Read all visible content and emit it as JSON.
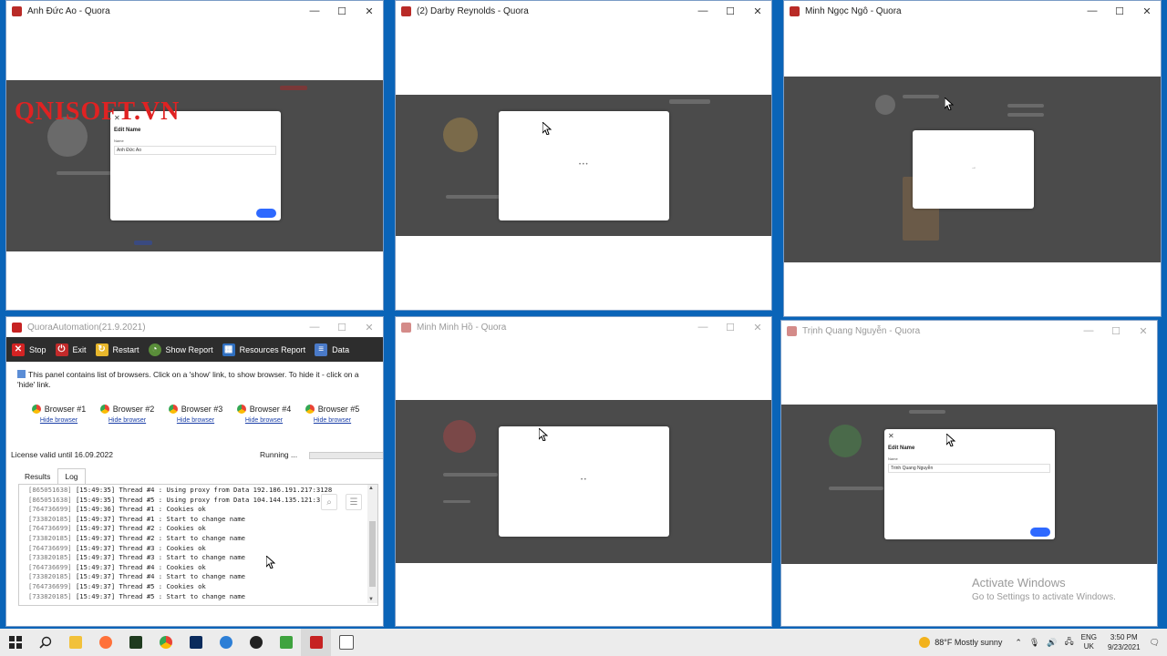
{
  "windows": {
    "w1": {
      "title": "Anh Đức Ao - Quora",
      "modal": {
        "title": "Edit Name",
        "label": "Name",
        "value": "Anh Đức Ao"
      }
    },
    "w2": {
      "title": "(2) Darby Reynolds - Quora",
      "spinner": "• • •"
    },
    "w3": {
      "title": "Minh Ngọc Ngô - Quora",
      "spinner": "→"
    },
    "w4": {
      "title": "Minh Minh Hồ - Quora",
      "spinner": "• •"
    },
    "w5": {
      "title": "Trịnh Quang Nguyễn - Quora",
      "modal": {
        "title": "Edit Name",
        "label": "Name",
        "value": "Trinh Quang Nguyễn"
      }
    }
  },
  "watermark": "QNISOFT.VN",
  "app": {
    "title": "QuoraAutomation(21.9.2021)",
    "toolbar": {
      "stop": "Stop",
      "exit": "Exit",
      "restart": "Restart",
      "show_report": "Show Report",
      "resources_report": "Resources Report",
      "data": "Data"
    },
    "info": "This panel contains list of browsers. Click on a 'show' link, to show browser. To hide it - click on a 'hide' link.",
    "browsers": [
      {
        "name": "Browser #1",
        "link": "Hide browser"
      },
      {
        "name": "Browser #2",
        "link": "Hide browser"
      },
      {
        "name": "Browser #3",
        "link": "Hide browser"
      },
      {
        "name": "Browser #4",
        "link": "Hide browser"
      },
      {
        "name": "Browser #5",
        "link": "Hide browser"
      }
    ],
    "license": "License valid until 16.09.2022",
    "status": "Running ...",
    "tabs": [
      "Results",
      "Log"
    ],
    "log": [
      {
        "id": "[865051638]",
        "text": "[15:49:35] Thread #4 : Using proxy from Data 192.186.191.217:3128"
      },
      {
        "id": "[865051638]",
        "text": "[15:49:35] Thread #5 : Using proxy from Data 104.144.135.121:3128"
      },
      {
        "id": "[764736699]",
        "text": "[15:49:36] Thread #1 : Cookies ok"
      },
      {
        "id": "[733820185]",
        "text": "[15:49:37] Thread #1 : Start to change name"
      },
      {
        "id": "[764736699]",
        "text": "[15:49:37] Thread #2 : Cookies ok"
      },
      {
        "id": "[733820185]",
        "text": "[15:49:37] Thread #2 : Start to change name"
      },
      {
        "id": "[764736699]",
        "text": "[15:49:37] Thread #3 : Cookies ok"
      },
      {
        "id": "[733820185]",
        "text": "[15:49:37] Thread #3 : Start to change name"
      },
      {
        "id": "[764736699]",
        "text": "[15:49:37] Thread #4 : Cookies ok"
      },
      {
        "id": "[733820185]",
        "text": "[15:49:37] Thread #4 : Start to change name"
      },
      {
        "id": "[764736699]",
        "text": "[15:49:37] Thread #5 : Cookies ok"
      },
      {
        "id": "[733820185]",
        "text": "[15:49:37] Thread #5 : Start to change name"
      }
    ]
  },
  "activate": {
    "line1": "Activate Windows",
    "line2": "Go to Settings to activate Windows."
  },
  "taskbar": {
    "weather": "88°F  Mostly sunny",
    "lang1": "ENG",
    "lang2": "UK",
    "time": "3:50 PM",
    "date": "9/23/2021",
    "icons": [
      "windows-start-icon",
      "search-icon",
      "file-explorer-icon",
      "firefox-icon",
      "app-icon",
      "chrome-icon",
      "photoshop-icon",
      "edge-icon",
      "steam-icon",
      "excel-icon",
      "quora-automation-icon",
      "app-window-icon"
    ]
  },
  "colors": {
    "desktop": "#0a64b8",
    "overlay": "#4b4b4b",
    "accent": "#2e69ff",
    "toolbar": "#2d2d2d",
    "watermark": "#e02222"
  }
}
